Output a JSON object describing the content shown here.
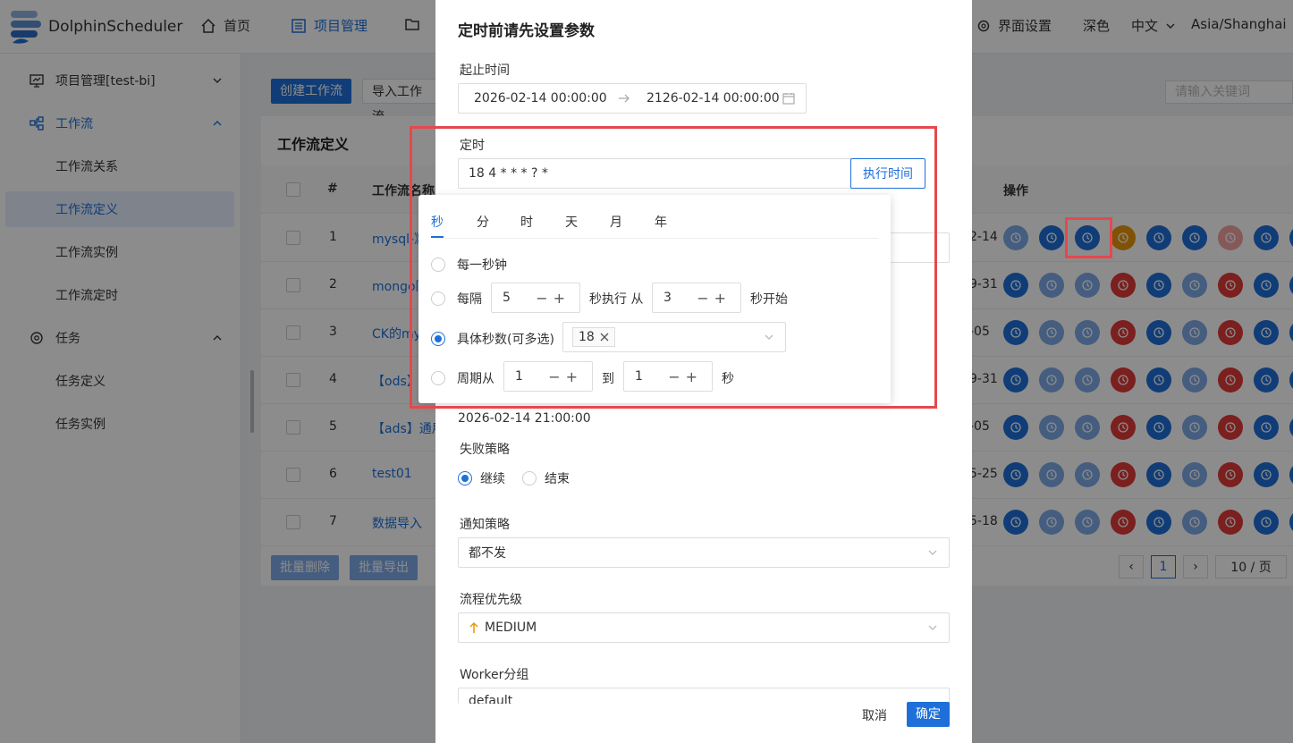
{
  "header": {
    "logo_text": "DolphinScheduler",
    "nav": {
      "home": "首页",
      "project": "项目管理",
      "ui_settings": "界面设置",
      "theme": "深色",
      "lang": "中文",
      "timezone": "Asia/Shanghai"
    }
  },
  "sidebar": {
    "items": [
      {
        "label": "项目管理[test-bi]"
      },
      {
        "label": "工作流"
      },
      {
        "label": "工作流关系"
      },
      {
        "label": "工作流定义"
      },
      {
        "label": "工作流实例"
      },
      {
        "label": "工作流定时"
      },
      {
        "label": "任务"
      },
      {
        "label": "任务定义"
      },
      {
        "label": "任务实例"
      }
    ]
  },
  "toolbar": {
    "create": "创建工作流",
    "import": "导入工作流",
    "search_placeholder": "请输入关键词"
  },
  "card": {
    "title": "工作流定义"
  },
  "table": {
    "headers": {
      "index": "#",
      "name": "工作流名称",
      "ops": "操作"
    },
    "rows": [
      {
        "index": "1",
        "name": "mysql-》",
        "date": "2-14"
      },
      {
        "index": "2",
        "name": "mongo同",
        "date": "9-31"
      },
      {
        "index": "3",
        "name": "CK的my",
        "date": "-05"
      },
      {
        "index": "4",
        "name": "【ods】",
        "date": "9-31"
      },
      {
        "index": "5",
        "name": "【ads】通用",
        "date": "-05"
      },
      {
        "index": "6",
        "name": "test01",
        "date": "5-25"
      },
      {
        "index": "7",
        "name": "数据导入",
        "date": "5-18"
      }
    ]
  },
  "footer": {
    "batch_delete": "批量删除",
    "batch_export": "批量导出",
    "page": "1",
    "page_size": "10 / 页",
    "prev": "‹",
    "next": "›"
  },
  "modal": {
    "title": "定时前请先设置参数",
    "range_label": "起止时间",
    "start": "2026-02-14 00:00:00",
    "end": "2126-02-14 00:00:00",
    "cron_label": "定时",
    "cron_value": "18 4 * * * ? *",
    "exec_time_btn": "执行时间",
    "next_time": "2026-02-14 21:00:00",
    "fail_label": "失败策略",
    "fail_continue": "继续",
    "fail_end": "结束",
    "notify_label": "通知策略",
    "notify_value": "都不发",
    "priority_label": "流程优先级",
    "priority_value": "MEDIUM",
    "worker_label": "Worker分组",
    "worker_value": "default",
    "cancel": "取消",
    "ok": "确定"
  },
  "cron": {
    "tabs": [
      "秒",
      "分",
      "时",
      "天",
      "月",
      "年"
    ],
    "every": "每一秒钟",
    "interval_prefix": "每隔",
    "interval_value": "5",
    "interval_mid": "秒执行 从",
    "interval_start": "3",
    "interval_suffix": "秒开始",
    "specific": "具体秒数(可多选)",
    "specific_tag": "18",
    "cycle_prefix": "周期从",
    "cycle_from": "1",
    "cycle_to_label": "到",
    "cycle_to": "1",
    "cycle_suffix": "秒"
  },
  "colors": {
    "primary": "#1e6fd9",
    "danger": "#e03a3a",
    "warning": "#e8960c",
    "highlight": "#e5484d"
  }
}
